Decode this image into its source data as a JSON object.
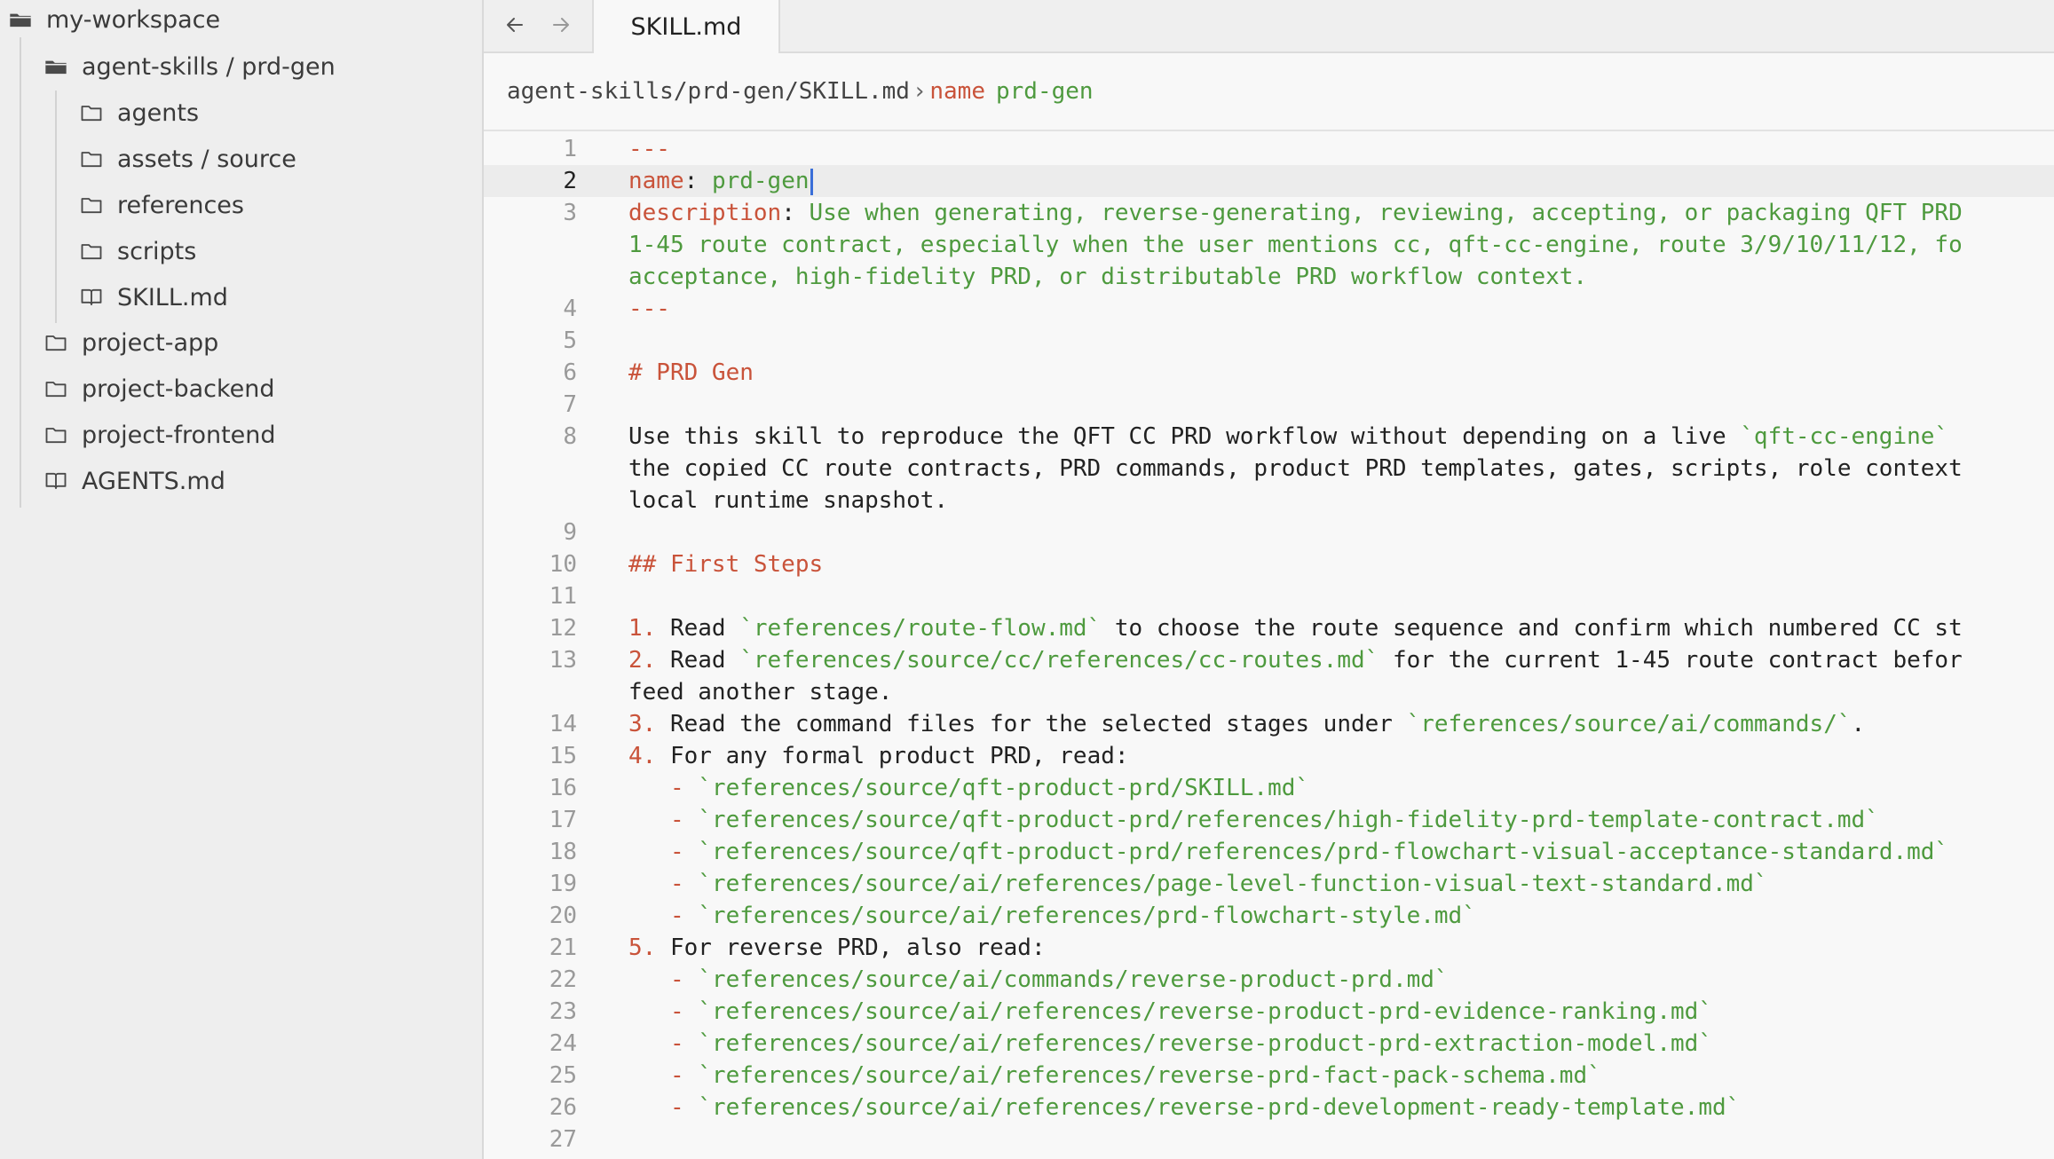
{
  "sidebar": {
    "root": "my-workspace",
    "skill_folder": "agent-skills / prd-gen",
    "children": {
      "agents": "agents",
      "assets": "assets / source",
      "references": "references",
      "scripts": "scripts",
      "skill_md": "SKILL.md"
    },
    "project_app": "project-app",
    "project_backend": "project-backend",
    "project_frontend": "project-frontend",
    "agents_md": "AGENTS.md"
  },
  "tabs": {
    "active": "SKILL.md"
  },
  "breadcrumb": {
    "path": "agent-skills/prd-gen/SKILL.md",
    "separator": "›",
    "key": "name",
    "value": "prd-gen"
  },
  "editor": {
    "line_numbers": [
      "1",
      "2",
      "3",
      "4",
      "5",
      "6",
      "7",
      "8",
      "9",
      "10",
      "11",
      "12",
      "13",
      "14",
      "15",
      "16",
      "17",
      "18",
      "19",
      "20",
      "21",
      "22",
      "23",
      "24",
      "25",
      "26",
      "27"
    ],
    "code": {
      "l1": "---",
      "l2_key": "name",
      "l2_colon": ": ",
      "l2_val": "prd-gen",
      "l3_key": "description",
      "l3_colon": ": ",
      "l3_a": "Use when generating, reverse-generating, reviewing, accepting, or packaging QFT PRD",
      "l3_b": "1-45 route contract, especially when the user mentions cc, qft-cc-engine, route 3/9/10/11/12, fo",
      "l3_c": "acceptance, high-fidelity PRD, or distributable PRD workflow context.",
      "l4": "---",
      "l6": "# PRD Gen",
      "l8_a1": "Use this skill to reproduce the QFT CC PRD workflow without depending on a live ",
      "l8_a2": "`qft-cc-engine`",
      "l8_b": "the copied CC route contracts, PRD commands, product PRD templates, gates, scripts, role context",
      "l8_c": "local runtime snapshot.",
      "l10": "## First Steps",
      "l12_n": "1.",
      "l12_t1": " Read ",
      "l12_c": "`references/route-flow.md`",
      "l12_t2": " to choose the route sequence and confirm which numbered CC st",
      "l13_n": "2.",
      "l13_t1": " Read ",
      "l13_c": "`references/source/cc/references/cc-routes.md`",
      "l13_t2": " for the current 1-45 route contract befor",
      "l13_b": "feed another stage.",
      "l14_n": "3.",
      "l14_t1": " Read the command files for the selected stages under ",
      "l14_c": "`references/source/ai/commands/`",
      "l14_t2": ".",
      "l15_n": "4.",
      "l15_t": " For any formal product PRD, read:",
      "l16": "`references/source/qft-product-prd/SKILL.md`",
      "l17": "`references/source/qft-product-prd/references/high-fidelity-prd-template-contract.md`",
      "l18": "`references/source/qft-product-prd/references/prd-flowchart-visual-acceptance-standard.md`",
      "l19": "`references/source/ai/references/page-level-function-visual-text-standard.md`",
      "l20": "`references/source/ai/references/prd-flowchart-style.md`",
      "l21_n": "5.",
      "l21_t": " For reverse PRD, also read:",
      "l22": "`references/source/ai/commands/reverse-product-prd.md`",
      "l23": "`references/source/ai/references/reverse-product-prd-evidence-ranking.md`",
      "l24": "`references/source/ai/references/reverse-product-prd-extraction-model.md`",
      "l25": "`references/source/ai/references/reverse-prd-fact-pack-schema.md`",
      "l26": "`references/source/ai/references/reverse-prd-development-ready-template.md`",
      "bullet": "   - "
    }
  },
  "colors": {
    "keyword": "#c9533a",
    "string": "#4e9a3e",
    "caret": "#3a6fd8",
    "sidebar_bg": "#eeeeee",
    "editor_bg": "#f8f8f8"
  }
}
